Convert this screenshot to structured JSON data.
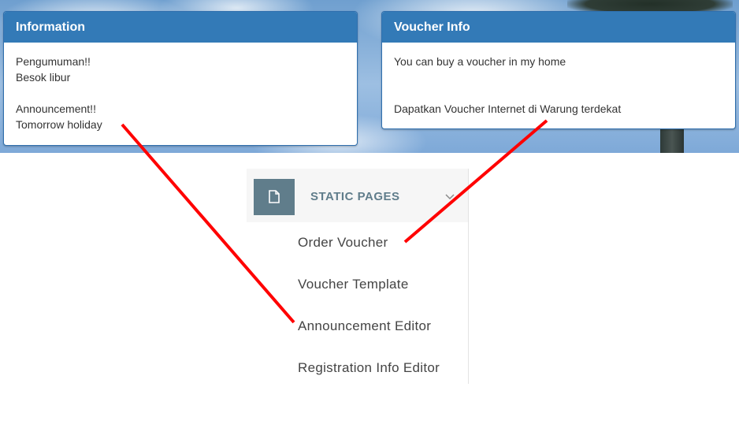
{
  "panels": {
    "information": {
      "title": "Information",
      "lines": [
        "Pengumuman!!",
        "Besok libur",
        "",
        "Announcement!!",
        "Tomorrow holiday"
      ]
    },
    "voucher_info": {
      "title": "Voucher Info",
      "lines": [
        "You can buy a voucher in my home",
        "",
        "Dapatkan Voucher Internet di Warung terdekat"
      ]
    }
  },
  "menu": {
    "section_title": "STATIC PAGES",
    "section_icon": "file-icon",
    "items": [
      {
        "label": "Order Voucher"
      },
      {
        "label": "Voucher Template"
      },
      {
        "label": "Announcement Editor"
      },
      {
        "label": "Registration Info Editor"
      }
    ]
  },
  "colors": {
    "panel_header": "#337ab7",
    "menu_accent": "#607d8b",
    "annotation_line": "#ff0000"
  }
}
